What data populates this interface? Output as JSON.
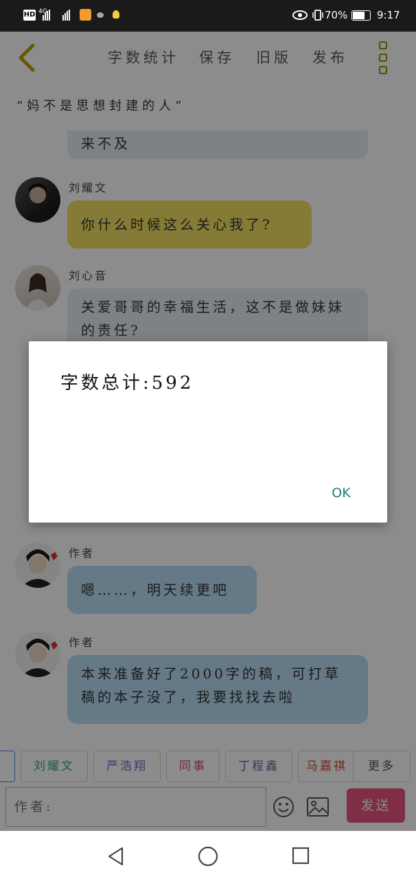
{
  "status_bar": {
    "hd": "HD",
    "network": "4G",
    "battery": "70%",
    "time": "9:17"
  },
  "toolbar": {
    "word_count": "字数统计",
    "save": "保存",
    "old_version": "旧版",
    "publish": "发布"
  },
  "subtitle": "“妈不是思想封建的人”",
  "chat": [
    {
      "name": "",
      "text": "来不及",
      "color": "grey"
    },
    {
      "name": "刘耀文",
      "text": "你什么时候这么关心我了?",
      "color": "yellow"
    },
    {
      "name": "刘心音",
      "text": "关爱哥哥的幸福生活，这不是做妹妹的责任?",
      "color": "grey"
    },
    {
      "name": "作者",
      "text": "嗯……，明天续更吧",
      "color": "blue"
    },
    {
      "name": "作者",
      "text": "本来准备好了2000字的稿，可打草稿的本子没了，我要找找去啦",
      "color": "blue"
    }
  ],
  "role_chips": [
    {
      "label": "刘耀文",
      "color": "#3aa86b"
    },
    {
      "label": "严浩翔",
      "color": "#7b5ec7"
    },
    {
      "label": "同事",
      "color": "#d44a6a"
    },
    {
      "label": "丁程鑫",
      "color": "#5a6c9a"
    },
    {
      "label": "马嘉祺",
      "color": "#d0452f"
    },
    {
      "label": "更多",
      "color": "#555555"
    }
  ],
  "input": {
    "placeholder": "作者:"
  },
  "send_label": "发送",
  "dialog": {
    "message": "字数总计:592",
    "ok_label": "OK"
  },
  "colors": {
    "accent": "#f2df63",
    "send": "#e7547f",
    "ok": "#1f7f7a"
  }
}
